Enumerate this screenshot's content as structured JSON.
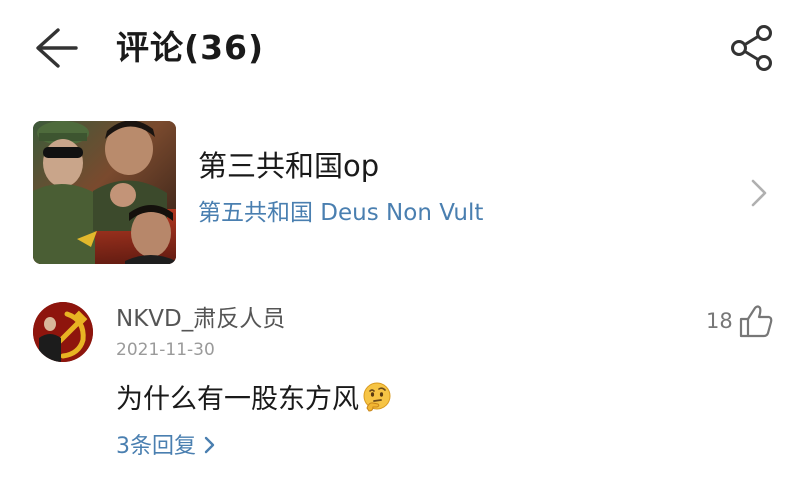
{
  "header": {
    "title": "评论(36)"
  },
  "album": {
    "title": "第三共和国op",
    "subtitle": "第五共和国 Deus Non Vult"
  },
  "comment": {
    "username": "NKVD_肃反人员",
    "date": "2021-11-30",
    "likes": "18",
    "text": "为什么有一股东方风",
    "emoji": "thinking-face-icon",
    "reply_label": "3条回复"
  },
  "colors": {
    "link": "#4a7fb0",
    "text": "#1a1a1a",
    "muted": "#9a9a9a"
  }
}
